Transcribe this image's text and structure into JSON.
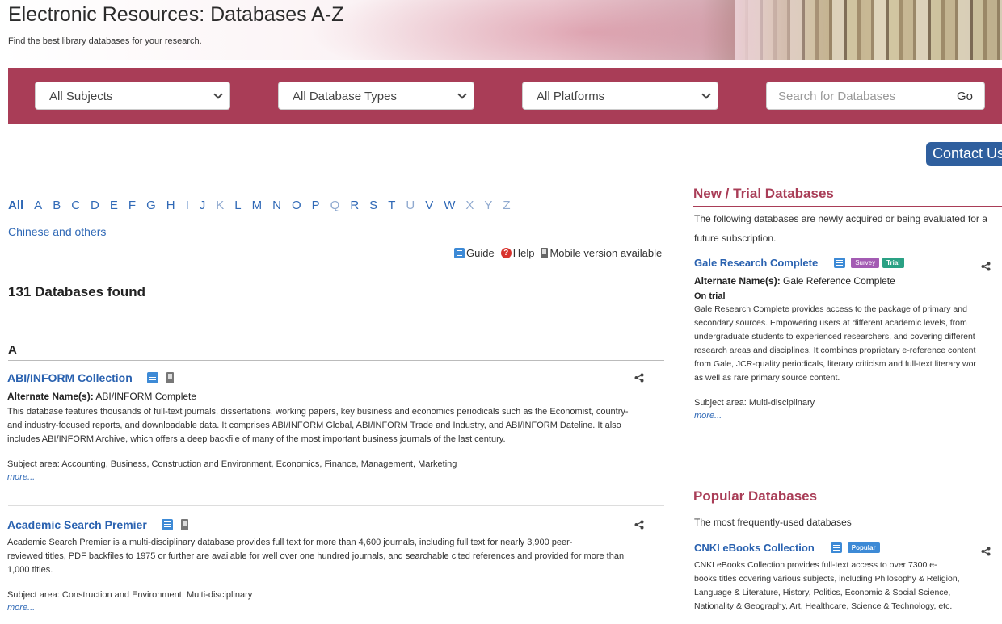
{
  "header": {
    "title": "Electronic Resources: Databases A-Z",
    "subtitle": "Find the best library databases for your research."
  },
  "filters": {
    "subjects": "All Subjects",
    "types": "All Database Types",
    "platforms": "All Platforms",
    "search_placeholder": "Search for Databases",
    "go_label": "Go"
  },
  "contact_label": "Contact Us",
  "alphabet": {
    "all": "All",
    "letters": [
      "A",
      "B",
      "C",
      "D",
      "E",
      "F",
      "G",
      "H",
      "I",
      "J",
      "K",
      "L",
      "M",
      "N",
      "O",
      "P",
      "Q",
      "R",
      "S",
      "T",
      "U",
      "V",
      "W",
      "X",
      "Y",
      "Z"
    ],
    "chinese": "Chinese and others"
  },
  "legend": {
    "guide": "Guide",
    "help": "Help",
    "mobile": "Mobile version available"
  },
  "results_count": "131 Databases found",
  "section_letter": "A",
  "entries": [
    {
      "title": "ABI/INFORM Collection",
      "alt_label": "Alternate Name(s):",
      "alt_value": "ABI/INFORM Complete",
      "desc_lines": [
        "This database features thousands of full-text journals, dissertations, working papers, key business and economics periodicals such as the Economist, country-",
        "and industry-focused reports, and downloadable data. It comprises ABI/INFORM Global, ABI/INFORM Trade and Industry, and ABI/INFORM Dateline. It also",
        "includes ABI/INFORM Archive, which offers a deep backfile of many of the most important business journals of the last century."
      ],
      "subject": "Subject area: Accounting, Business, Construction and Environment, Economics, Finance, Management, Marketing",
      "more": "more..."
    },
    {
      "title": "Academic Search Premier",
      "desc_lines": [
        "Academic Search Premier is a multi-disciplinary database provides full text for more than 4,600 journals, including full text for nearly 3,900 peer-",
        "reviewed titles, PDF backfiles to 1975 or further are available for well over one hundred journals, and searchable cited references and provided for more than",
        "1,000 titles."
      ],
      "subject": "Subject area: Construction and Environment, Multi-disciplinary",
      "more": "more..."
    }
  ],
  "new_trial": {
    "heading": "New / Trial Databases",
    "intro_lines": [
      "The following databases are newly acquired or being evaluated for a",
      "future subscription."
    ],
    "entry": {
      "title": "Gale Research Complete",
      "badge_survey": "Survey",
      "badge_trial": "Trial",
      "alt_label": "Alternate Name(s):",
      "alt_value": "Gale Reference Complete",
      "status": "On trial",
      "desc_lines": [
        "Gale Research Complete provides access to the package of primary and",
        "secondary sources. Empowering users at different academic levels, from",
        "undergraduate students to experienced researchers, and covering different",
        "research areas and disciplines. It combines proprietary e-reference content",
        "from Gale, JCR-quality periodicals, literary criticism and full-text literary wor",
        "as well as rare primary source content."
      ],
      "subject": "Subject area: Multi-disciplinary",
      "more": "more..."
    }
  },
  "popular": {
    "heading": "Popular Databases",
    "intro": "The most frequently-used databases",
    "entry": {
      "title": "CNKI eBooks Collection",
      "badge": "Popular",
      "desc_lines": [
        "CNKI eBooks Collection provides full-text access to over 7300 e-",
        "books titles covering various subjects, including Philosophy & Religion,",
        "Language & Literature, History, Politics, Economic & Social Science,",
        "Nationality & Geography, Art, Healthcare, Science & Technology, etc."
      ]
    }
  },
  "icons": [
    "guide-icon",
    "help-icon",
    "mobile-icon",
    "share-icon",
    "chevron-down-icon"
  ],
  "colors": {
    "brand": "#a93d57",
    "link": "#2a62b0",
    "contact": "#2f5f9e",
    "survey": "#a35bb3",
    "trial": "#2aa184",
    "popular": "#3d8ad6"
  }
}
